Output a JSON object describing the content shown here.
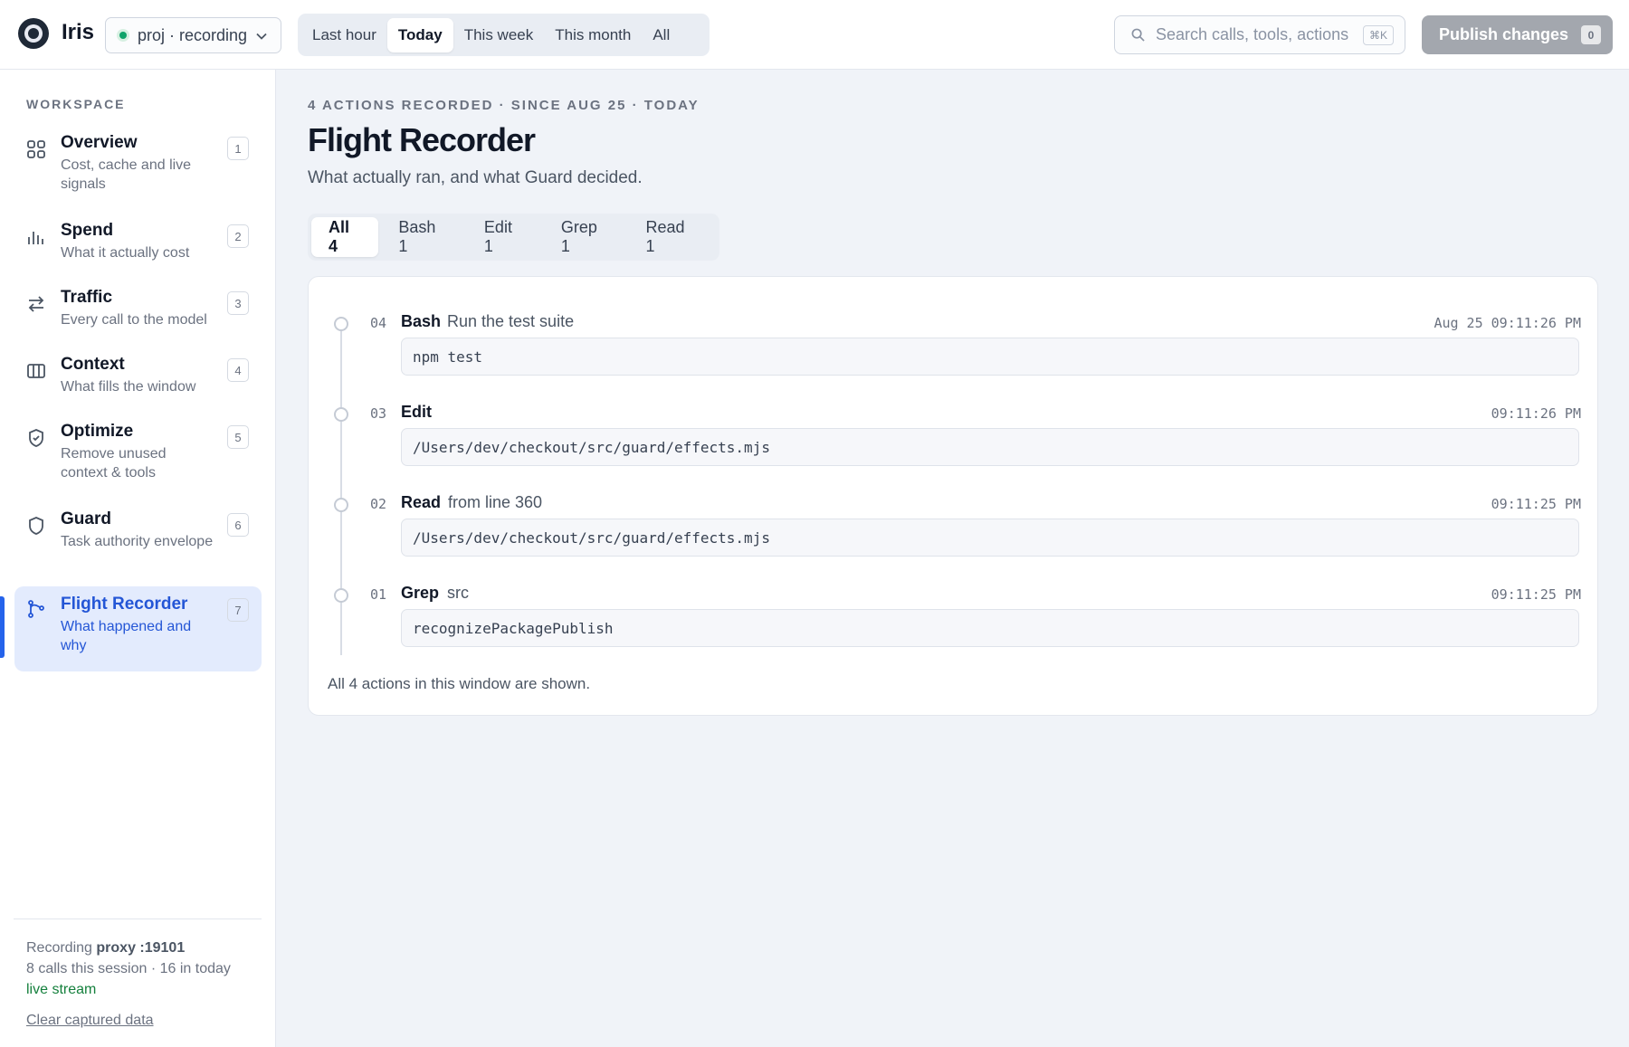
{
  "app": {
    "name": "Iris",
    "logo_icon": "iris-logo"
  },
  "project": {
    "label": "proj · recording",
    "status_color": "#10a36a"
  },
  "time_ranges": [
    {
      "label": "Last hour",
      "active": false
    },
    {
      "label": "Today",
      "active": true
    },
    {
      "label": "This week",
      "active": false
    },
    {
      "label": "This month",
      "active": false
    },
    {
      "label": "All",
      "active": false
    }
  ],
  "search": {
    "placeholder": "Search calls, tools, actions",
    "shortcut": "⌘K"
  },
  "publish": {
    "label": "Publish changes",
    "count": "0"
  },
  "sidebar": {
    "section_label": "WORKSPACE",
    "items": [
      {
        "title": "Overview",
        "desc": "Cost, cache and live signals",
        "num": "1",
        "icon": "grid-icon",
        "active": false
      },
      {
        "title": "Spend",
        "desc": "What it actually cost",
        "num": "2",
        "icon": "bar-chart-icon",
        "active": false
      },
      {
        "title": "Traffic",
        "desc": "Every call to the model",
        "num": "3",
        "icon": "arrows-swap-icon",
        "active": false
      },
      {
        "title": "Context",
        "desc": "What fills the window",
        "num": "4",
        "icon": "columns-icon",
        "active": false
      },
      {
        "title": "Optimize",
        "desc": "Remove unused context & tools",
        "num": "5",
        "icon": "shield-check-icon",
        "active": false
      },
      {
        "title": "Guard",
        "desc": "Task authority envelope",
        "num": "6",
        "icon": "shield-icon",
        "active": false
      },
      {
        "title": "Flight Recorder",
        "desc": "What happened and why",
        "num": "7",
        "icon": "branch-icon",
        "active": true
      }
    ],
    "footer": {
      "recording_prefix": "Recording",
      "proxy": "proxy :19101",
      "calls": "8 calls this session · 16 in today",
      "live": "live stream",
      "clear": "Clear captured data"
    }
  },
  "main": {
    "eyebrow": "4 ACTIONS RECORDED · SINCE AUG 25 · TODAY",
    "title": "Flight Recorder",
    "subtitle": "What actually ran, and what Guard decided.",
    "tabs": [
      {
        "label": "All 4",
        "active": true
      },
      {
        "label": "Bash 1",
        "active": false
      },
      {
        "label": "Edit 1",
        "active": false
      },
      {
        "label": "Grep 1",
        "active": false
      },
      {
        "label": "Read 1",
        "active": false
      }
    ],
    "entries": [
      {
        "idx": "04",
        "tool": "Bash",
        "summary": "Run the test suite",
        "time": "Aug 25 09:11:26 PM",
        "code": "npm test"
      },
      {
        "idx": "03",
        "tool": "Edit",
        "summary": "",
        "time": "09:11:26 PM",
        "code": "/Users/dev/checkout/src/guard/effects.mjs"
      },
      {
        "idx": "02",
        "tool": "Read",
        "summary": "from line 360",
        "time": "09:11:25 PM",
        "code": "/Users/dev/checkout/src/guard/effects.mjs"
      },
      {
        "idx": "01",
        "tool": "Grep",
        "summary": "src",
        "time": "09:11:25 PM",
        "code": "recognizePackagePublish"
      }
    ],
    "footer_note": "All 4 actions in this window are shown."
  },
  "colors": {
    "accent": "#2563eb",
    "live": "#15803d",
    "publish_disabled": "#a3a7ae"
  }
}
